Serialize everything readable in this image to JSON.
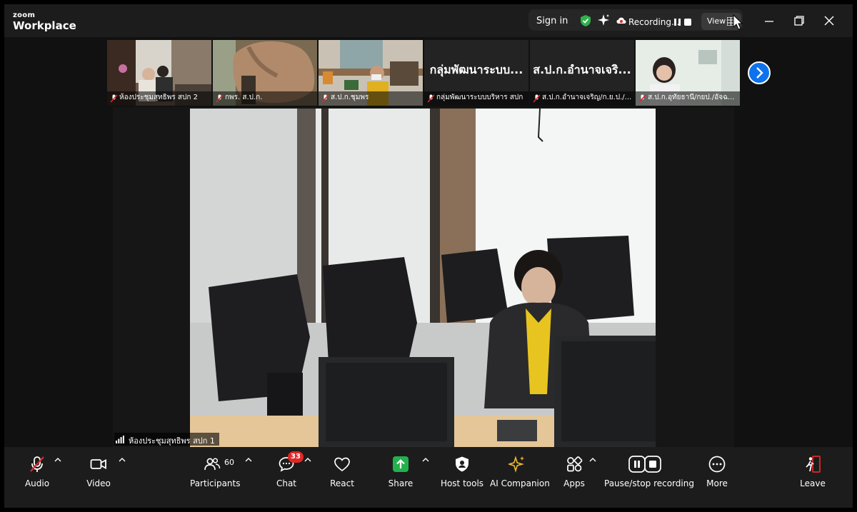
{
  "app": {
    "logo_top": "zoom",
    "logo_main": "Workplace"
  },
  "titlebar": {
    "sign_in": "Sign in",
    "recording_label": "Recording...",
    "view_label": "View"
  },
  "thumbnails": [
    {
      "name": "ห้องประชุมสุทธิพร สปก 2",
      "muted": true
    },
    {
      "name": "กพร. ส.ป.ก.",
      "muted": true
    },
    {
      "name": "ส.ป.ก.ชุมพร",
      "muted": true
    },
    {
      "name": "กลุ่มพัฒนาระบบบริหาร สปก",
      "big_name": "กลุ่มพัฒนาระบบ...",
      "muted": true
    },
    {
      "name": "ส.ป.ก.อำนาจเจริญ/ก.ย.ป./...",
      "big_name": "ส.ป.ก.อำนาจเจริ...",
      "muted": true
    },
    {
      "name": "ส.ป.ก.อุทัยธานี/กยป./อัจฉ...",
      "muted": true
    }
  ],
  "main": {
    "speaker_name": "ห้องประชุมสุทธิพร สปก 1"
  },
  "toolbar": {
    "audio": "Audio",
    "video": "Video",
    "participants": "Participants",
    "participants_count": "60",
    "chat": "Chat",
    "chat_badge": "33",
    "react": "React",
    "share": "Share",
    "host_tools": "Host tools",
    "ai_companion": "AI Companion",
    "apps": "Apps",
    "pause_stop_recording": "Pause/stop recording",
    "more": "More",
    "leave": "Leave"
  },
  "colors": {
    "accent_blue": "#0e72ed",
    "share_green": "#23b14d",
    "muted_red": "#e02828",
    "shield_green": "#2fb24c",
    "ai_gold": "#e8b530"
  }
}
